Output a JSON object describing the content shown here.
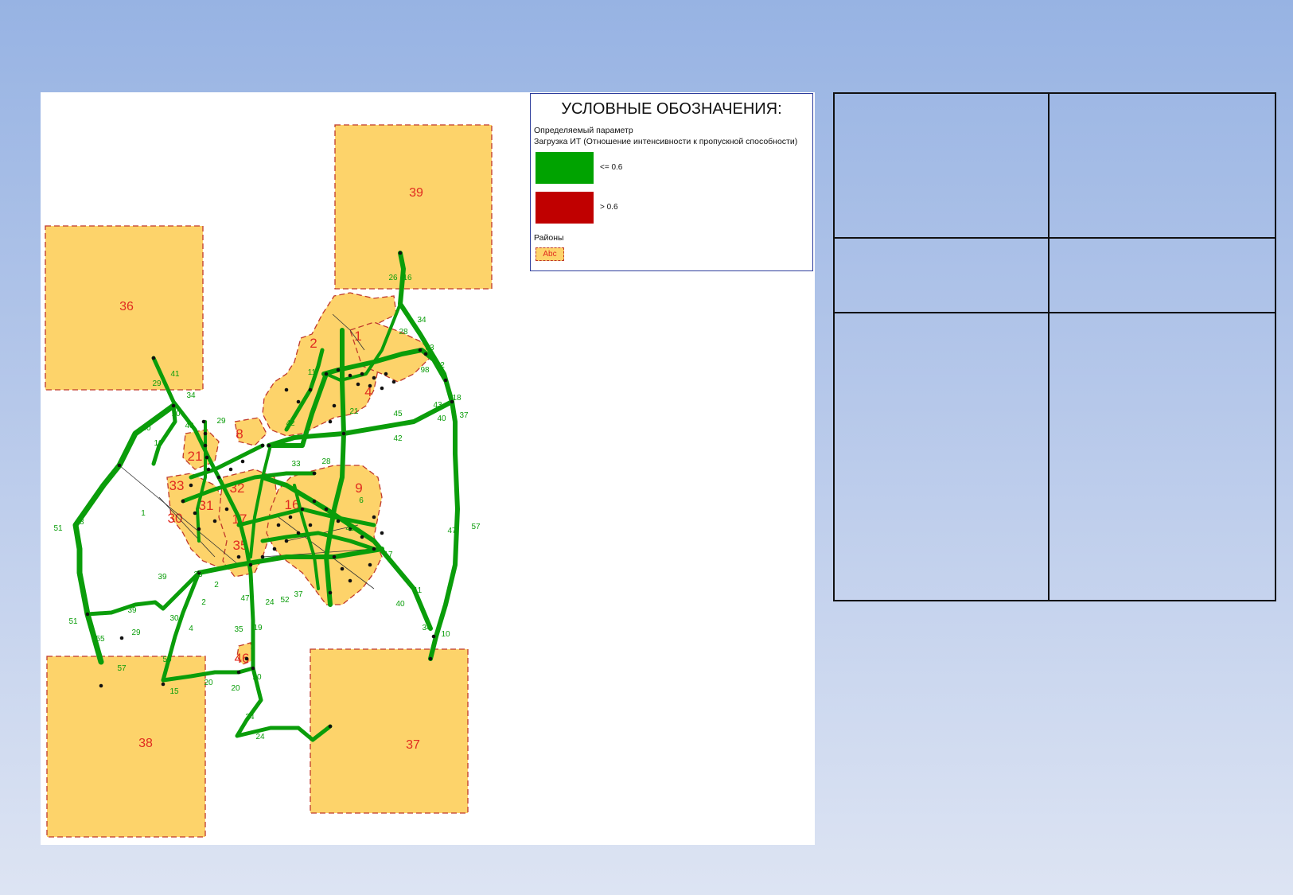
{
  "legend": {
    "title": "УСЛОВНЫЕ ОБОЗНАЧЕНИЯ:",
    "param_label": "Определяемый параметр",
    "param_description": "Загрузка ИТ (Отношение интенсивности к пропускной способности)",
    "ranges": [
      {
        "label": "<= 0.6",
        "color": "#00a300"
      },
      {
        "label": "> 0.6",
        "color": "#c00000"
      }
    ],
    "districts_label": "Районы",
    "district_sample": "Abc"
  },
  "map": {
    "district_color": "#fdd36a",
    "road_color": "#0a9d0a",
    "label_color": "#e02b20",
    "district_labels": [
      "39",
      "36",
      "38",
      "37",
      "1",
      "2",
      "4",
      "8",
      "9",
      "16",
      "21",
      "30",
      "31",
      "32",
      "33",
      "17",
      "35",
      "46"
    ],
    "road_labels": [
      "26",
      "16",
      "34",
      "28",
      "33",
      "2",
      "98",
      "18",
      "37",
      "43",
      "40",
      "45",
      "42",
      "47",
      "57",
      "41",
      "29",
      "34",
      "10",
      "40",
      "30",
      "10",
      "29",
      "11",
      "51",
      "48",
      "1",
      "39",
      "23",
      "2",
      "2",
      "4",
      "30",
      "39",
      "29",
      "51",
      "55",
      "50",
      "57",
      "47",
      "24",
      "52",
      "37",
      "40",
      "11",
      "34",
      "10",
      "19",
      "35",
      "20",
      "20",
      "15",
      "20",
      "34",
      "24",
      "42",
      "33",
      "21",
      "28",
      "17",
      "6",
      "45"
    ]
  },
  "table": {
    "rows": [
      [
        "",
        ""
      ],
      [
        "",
        ""
      ],
      [
        "",
        ""
      ]
    ]
  }
}
